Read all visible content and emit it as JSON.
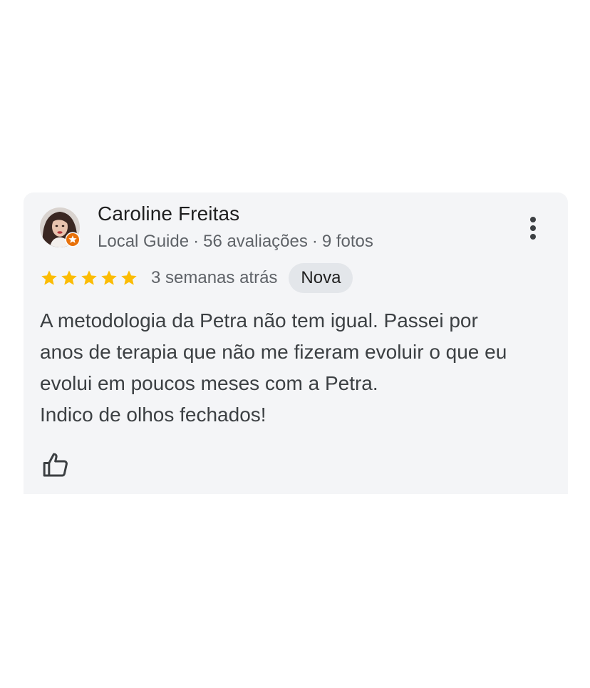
{
  "review": {
    "author_name": "Caroline Freitas",
    "author_level": "Local Guide",
    "reviews_count": "56 avaliações",
    "photos_count": "9 fotos",
    "separator": "·",
    "rating": 5,
    "rating_max": 5,
    "date": "3 semanas atrás",
    "new_badge": "Nova",
    "text_lines": [
      "A metodologia da Petra não tem igual. Passei por",
      "anos de terapia que não me fizeram evoluir o que eu",
      "evolui em poucos meses com a Petra.",
      "Indico de olhos fechados!"
    ]
  },
  "colors": {
    "card_bg": "#f4f5f7",
    "star": "#fbbc04",
    "guide_badge": "#e8710a",
    "text_primary": "#1f1f1f",
    "text_secondary": "#5f6368"
  },
  "icons": {
    "more": "more-vert-icon",
    "like": "thumbs-up-icon",
    "badge": "local-guide-star-icon",
    "star": "star-icon"
  }
}
